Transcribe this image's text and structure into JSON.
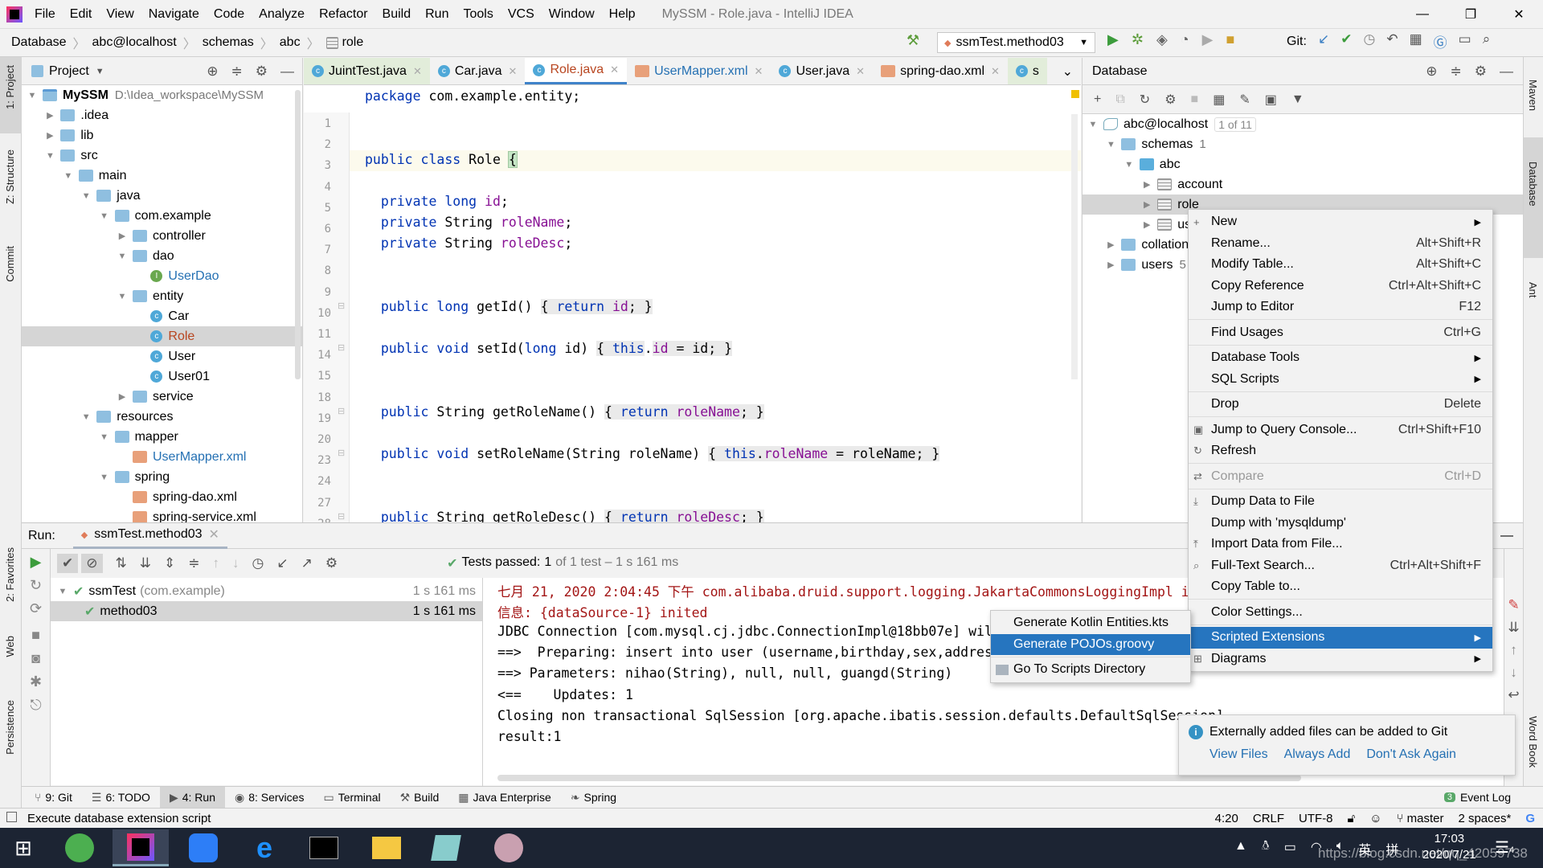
{
  "app": {
    "title": "MySSM - Role.java - IntelliJ IDEA"
  },
  "menu": [
    "File",
    "Edit",
    "View",
    "Navigate",
    "Code",
    "Analyze",
    "Refactor",
    "Build",
    "Run",
    "Tools",
    "VCS",
    "Window",
    "Help"
  ],
  "window_controls": {
    "minimize": "—",
    "restore": "❐",
    "close": "✕"
  },
  "breadcrumb": [
    "Database",
    "abc@localhost",
    "schemas",
    "abc",
    "role"
  ],
  "toolbar": {
    "run_config": "ssmTest.method03",
    "git_label": "Git:"
  },
  "left_stripe": [
    "1: Project",
    "Z: Structure",
    "Commit",
    "2: Favorites",
    "Web",
    "Persistence"
  ],
  "right_stripe": [
    "Maven",
    "Database",
    "Ant",
    "Word Book"
  ],
  "project": {
    "title": "Project",
    "rows": [
      {
        "label": "MySSM",
        "extra": "D:\\Idea_workspace\\MySSM",
        "depth": 0,
        "arrow": "down",
        "icon": "module",
        "bold": true
      },
      {
        "label": ".idea",
        "depth": 1,
        "arrow": "right",
        "icon": "folder"
      },
      {
        "label": "lib",
        "depth": 1,
        "arrow": "right",
        "icon": "folder"
      },
      {
        "label": "src",
        "depth": 1,
        "arrow": "down",
        "icon": "folder"
      },
      {
        "label": "main",
        "depth": 2,
        "arrow": "down",
        "icon": "folder"
      },
      {
        "label": "java",
        "depth": 3,
        "arrow": "down",
        "icon": "folder"
      },
      {
        "label": "com.example",
        "depth": 4,
        "arrow": "down",
        "icon": "folder"
      },
      {
        "label": "controller",
        "depth": 5,
        "arrow": "right",
        "icon": "folder"
      },
      {
        "label": "dao",
        "depth": 5,
        "arrow": "down",
        "icon": "folder"
      },
      {
        "label": "UserDao",
        "depth": 6,
        "arrow": "",
        "icon": "interface",
        "color": "#2470b3"
      },
      {
        "label": "entity",
        "depth": 5,
        "arrow": "down",
        "icon": "folder"
      },
      {
        "label": "Car",
        "depth": 6,
        "arrow": "",
        "icon": "class"
      },
      {
        "label": "Role",
        "depth": 6,
        "arrow": "",
        "icon": "class",
        "color": "#b8451f",
        "selected": true
      },
      {
        "label": "User",
        "depth": 6,
        "arrow": "",
        "icon": "class"
      },
      {
        "label": "User01",
        "depth": 6,
        "arrow": "",
        "icon": "class"
      },
      {
        "label": "service",
        "depth": 5,
        "arrow": "right",
        "icon": "folder"
      },
      {
        "label": "resources",
        "depth": 3,
        "arrow": "down",
        "icon": "folder"
      },
      {
        "label": "mapper",
        "depth": 4,
        "arrow": "down",
        "icon": "folder"
      },
      {
        "label": "UserMapper.xml",
        "depth": 5,
        "arrow": "",
        "icon": "xml",
        "color": "#2470b3"
      },
      {
        "label": "spring",
        "depth": 4,
        "arrow": "down",
        "icon": "folder"
      },
      {
        "label": "spring-dao.xml",
        "depth": 5,
        "arrow": "",
        "icon": "xml"
      },
      {
        "label": "spring-service.xml",
        "depth": 5,
        "arrow": "",
        "icon": "xml"
      }
    ]
  },
  "editor": {
    "tabs": [
      {
        "label": "JuintTest.java",
        "icon": "class",
        "style": "test"
      },
      {
        "label": "Car.java",
        "icon": "class"
      },
      {
        "label": "Role.java",
        "icon": "class",
        "active": true,
        "color": "#b8451f"
      },
      {
        "label": "UserMapper.xml",
        "icon": "xml",
        "color": "#2470b3"
      },
      {
        "label": "User.java",
        "icon": "class"
      },
      {
        "label": "spring-dao.xml",
        "icon": "xml"
      },
      {
        "label": "s",
        "icon": "class",
        "style": "test"
      }
    ],
    "tabs_overflow": "⌄",
    "lines": [
      {
        "n": "1",
        "t": [
          [
            "package ",
            "kw"
          ],
          [
            "com.example.entity;",
            ""
          ]
        ]
      },
      {
        "n": "2",
        "t": []
      },
      {
        "n": "3",
        "t": []
      },
      {
        "n": "4",
        "t": [
          [
            "public class ",
            "kw"
          ],
          [
            "Role ",
            ""
          ],
          [
            "{",
            "bhl"
          ]
        ],
        "current": true
      },
      {
        "n": "5",
        "t": []
      },
      {
        "n": "6",
        "t": [
          [
            "  private long ",
            "kw"
          ],
          [
            "id",
            "fld"
          ],
          [
            ";",
            ""
          ]
        ]
      },
      {
        "n": "7",
        "t": [
          [
            "  private ",
            "kw"
          ],
          [
            "String ",
            ""
          ],
          [
            "roleName",
            "fld"
          ],
          [
            ";",
            ""
          ]
        ]
      },
      {
        "n": "8",
        "t": [
          [
            "  private ",
            "kw"
          ],
          [
            "String ",
            ""
          ],
          [
            "roleDesc",
            "fld"
          ],
          [
            ";",
            ""
          ]
        ]
      },
      {
        "n": "9",
        "t": []
      },
      {
        "n": "10",
        "t": []
      },
      {
        "n": "11",
        "t": [
          [
            "  public long ",
            "kw"
          ],
          [
            "getId() ",
            ""
          ],
          [
            "{ ",
            "fold"
          ],
          [
            "return ",
            "kw fold"
          ],
          [
            "id",
            "fld fold"
          ],
          [
            "; }",
            "fold"
          ]
        ]
      },
      {
        "n": "14",
        "t": []
      },
      {
        "n": "15",
        "t": [
          [
            "  public void ",
            "kw"
          ],
          [
            "setId(",
            ""
          ],
          [
            "long ",
            "kw"
          ],
          [
            "id) ",
            ""
          ],
          [
            "{ ",
            "fold"
          ],
          [
            "this",
            "kw fold"
          ],
          [
            ".",
            ""
          ],
          [
            "id",
            "fld fold"
          ],
          [
            " = id; }",
            "fold"
          ]
        ]
      },
      {
        "n": "18",
        "t": []
      },
      {
        "n": "19",
        "t": []
      },
      {
        "n": "20",
        "t": [
          [
            "  public ",
            "kw"
          ],
          [
            "String getRoleName() ",
            ""
          ],
          [
            "{ ",
            "fold"
          ],
          [
            "return ",
            "kw fold"
          ],
          [
            "roleName",
            "fld fold"
          ],
          [
            "; }",
            "fold"
          ]
        ]
      },
      {
        "n": "23",
        "t": []
      },
      {
        "n": "24",
        "t": [
          [
            "  public void ",
            "kw"
          ],
          [
            "setRoleName(String roleName) ",
            ""
          ],
          [
            "{ ",
            "fold"
          ],
          [
            "this",
            "kw fold"
          ],
          [
            ".",
            "fold"
          ],
          [
            "roleName",
            "fld fold"
          ],
          [
            " = roleName; }",
            "fold"
          ]
        ]
      },
      {
        "n": "27",
        "t": []
      },
      {
        "n": "28",
        "t": []
      },
      {
        "n": "29",
        "t": [
          [
            "  public ",
            "kw"
          ],
          [
            "String getRoleDesc() ",
            ""
          ],
          [
            "{ ",
            "fold"
          ],
          [
            "return ",
            "kw fold"
          ],
          [
            "roleDesc",
            "fld fold"
          ],
          [
            "; }",
            "fold"
          ]
        ]
      }
    ]
  },
  "database": {
    "title": "Database",
    "rows": [
      {
        "label": "abc@localhost",
        "badge": "1 of 11",
        "depth": 0,
        "arrow": "down",
        "icon": "db"
      },
      {
        "label": "schemas",
        "extra": "1",
        "depth": 1,
        "arrow": "down",
        "icon": "folder"
      },
      {
        "label": "abc",
        "depth": 2,
        "arrow": "down",
        "icon": "schema"
      },
      {
        "label": "account",
        "depth": 3,
        "arrow": "right",
        "icon": "table"
      },
      {
        "label": "role",
        "depth": 3,
        "arrow": "right",
        "icon": "table",
        "selected": true
      },
      {
        "label": "user",
        "depth": 3,
        "arrow": "right",
        "icon": "table"
      },
      {
        "label": "collations",
        "depth": 1,
        "arrow": "right",
        "icon": "folder"
      },
      {
        "label": "users",
        "extra": "5",
        "depth": 1,
        "arrow": "right",
        "icon": "folder"
      }
    ]
  },
  "context_menu": {
    "items": [
      {
        "label": "New",
        "icon": "+",
        "submenu": true
      },
      {
        "label": "Rename...",
        "shortcut": "Alt+Shift+R"
      },
      {
        "label": "Modify Table...",
        "shortcut": "Alt+Shift+C"
      },
      {
        "label": "Copy Reference",
        "shortcut": "Ctrl+Alt+Shift+C"
      },
      {
        "label": "Jump to Editor",
        "shortcut": "F12",
        "sep_after": true
      },
      {
        "label": "Find Usages",
        "shortcut": "Ctrl+G",
        "sep_after": true
      },
      {
        "label": "Database Tools",
        "submenu": true
      },
      {
        "label": "SQL Scripts",
        "submenu": true,
        "sep_after": true
      },
      {
        "label": "Drop",
        "shortcut": "Delete",
        "sep_after": true
      },
      {
        "label": "Jump to Query Console...",
        "shortcut": "Ctrl+Shift+F10",
        "icon": "▣"
      },
      {
        "label": "Refresh",
        "icon": "↻",
        "sep_after": true
      },
      {
        "label": "Compare",
        "shortcut": "Ctrl+D",
        "disabled": true,
        "icon": "⇄",
        "sep_after": true
      },
      {
        "label": "Dump Data to File",
        "icon": "⤓"
      },
      {
        "label": "Dump with 'mysqldump'"
      },
      {
        "label": "Import Data from File...",
        "icon": "⤒"
      },
      {
        "label": "Full-Text Search...",
        "shortcut": "Ctrl+Alt+Shift+F",
        "icon": "⌕"
      },
      {
        "label": "Copy Table to...",
        "sep_after": true
      },
      {
        "label": "Color Settings...",
        "sep_after": true
      },
      {
        "label": "Scripted Extensions",
        "submenu": true,
        "highlighted": true
      },
      {
        "label": "Diagrams",
        "submenu": true,
        "icon": "⊞"
      }
    ]
  },
  "submenu": {
    "items": [
      {
        "label": "Generate Kotlin Entities.kts"
      },
      {
        "label": "Generate POJOs.groovy",
        "highlighted": true,
        "sep_after": true
      },
      {
        "label": "Go To Scripts Directory",
        "icon": "folder"
      }
    ]
  },
  "run": {
    "label": "Run:",
    "tab": "ssmTest.method03",
    "status_prefix": "Tests passed:",
    "status_count": "1",
    "status_rest": "of 1 test – 1 s 161 ms",
    "tree": [
      {
        "label": "ssmTest",
        "extra": "(com.example)",
        "time": "1 s 161 ms"
      },
      {
        "label": "method03",
        "time": "1 s 161 ms",
        "selected": true
      }
    ],
    "console": [
      {
        "text": "七月 21, 2020 2:04:45 下午 com.alibaba.druid.support.logging.JakartaCommonsLoggingImpl info",
        "color": "#a31515"
      },
      {
        "text": "信息: {dataSource-1} inited",
        "color": "#a31515"
      },
      {
        "text": "JDBC Connection [com.mysql.cj.jdbc.ConnectionImpl@18bb07e] will not be managed by Spring"
      },
      {
        "text": "==>  Preparing: insert into user (username,birthday,sex,address) values (?,?,?,?)"
      },
      {
        "text": "==> Parameters: nihao(String), null, null, guangd(String)"
      },
      {
        "text": "<==    Updates: 1"
      },
      {
        "text": "Closing non transactional SqlSession [org.apache.ibatis.session.defaults.DefaultSqlSession]"
      },
      {
        "text": "result:1"
      }
    ]
  },
  "notification": {
    "message": "Externally added files can be added to Git",
    "actions": [
      "View Files",
      "Always Add",
      "Don't Ask Again"
    ]
  },
  "bottom_tools": [
    {
      "label": "9: Git",
      "icon": "⑂"
    },
    {
      "label": "6: TODO",
      "icon": "☰"
    },
    {
      "label": "4: Run",
      "icon": "▶",
      "active": true
    },
    {
      "label": "8: Services",
      "icon": "◉"
    },
    {
      "label": "Terminal",
      "icon": "▭"
    },
    {
      "label": "Build",
      "icon": "⚒"
    },
    {
      "label": "Java Enterprise",
      "icon": "▦"
    },
    {
      "label": "Spring",
      "icon": "❧"
    }
  ],
  "event_log": {
    "label": "Event Log",
    "count": "3"
  },
  "status": {
    "message": "Execute database extension script",
    "position": "4:20",
    "line_sep": "CRLF",
    "encoding": "UTF-8",
    "branch": "master",
    "indent": "2 spaces*"
  },
  "taskbar": {
    "time": "17:03",
    "date": "2020/7/21",
    "ime1": "英",
    "ime2": "拼",
    "notif_count": "4"
  },
  "watermark": "https://blog.csdn.net/qq_42059738",
  "colors": {
    "accent": "#2675bf",
    "selection": "#d5d5d5",
    "keyword": "#0033b3",
    "field": "#871094",
    "error_text": "#a31515",
    "success": "#59a869"
  }
}
